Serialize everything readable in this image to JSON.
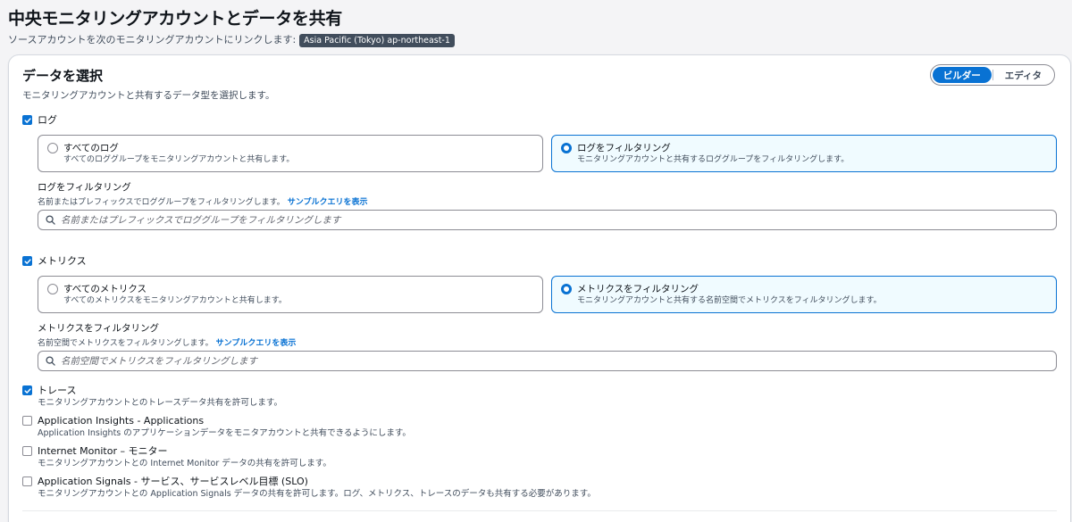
{
  "header": {
    "title": "中央モニタリングアカウントとデータを共有",
    "subtitle": "ソースアカウントを次のモニタリングアカウントにリンクします:",
    "region_badge": "Asia Pacific (Tokyo) ap-northeast-1"
  },
  "card": {
    "title": "データを選択",
    "description": "モニタリングアカウントと共有するデータ型を選択します。",
    "mode_toggle": {
      "builder_label": "ビルダー",
      "editor_label": "エディタ",
      "selected": "ビルダー"
    },
    "logs": {
      "label": "ログ",
      "checked": true,
      "option_all": {
        "label": "すべてのログ",
        "description": "すべてのロググループをモニタリングアカウントと共有します。"
      },
      "option_filter": {
        "label": "ログをフィルタリング",
        "description": "モニタリングアカウントと共有するロググループをフィルタリングします。"
      },
      "selected_option": "filter",
      "filter": {
        "label": "ログをフィルタリング",
        "description": "名前またはプレフィックスでロググループをフィルタリングします。",
        "link": "サンプルクエリを表示",
        "placeholder": "名前またはプレフィックスでロググループをフィルタリングします",
        "value": ""
      }
    },
    "metrics": {
      "label": "メトリクス",
      "checked": true,
      "option_all": {
        "label": "すべてのメトリクス",
        "description": "すべてのメトリクスをモニタリングアカウントと共有します。"
      },
      "option_filter": {
        "label": "メトリクスをフィルタリング",
        "description": "モニタリングアカウントと共有する名前空間でメトリクスをフィルタリングします。"
      },
      "selected_option": "filter",
      "filter": {
        "label": "メトリクスをフィルタリング",
        "description": "名前空間でメトリクスをフィルタリングします。",
        "link": "サンプルクエリを表示",
        "placeholder": "名前空間でメトリクスをフィルタリングします",
        "value": ""
      }
    },
    "traces": {
      "label": "トレース",
      "description": "モニタリングアカウントとのトレースデータ共有を許可します。",
      "checked": true
    },
    "app_insights": {
      "label": "Application Insights - Applications",
      "description": "Application Insights のアプリケーションデータをモニタアカウントと共有できるようにします。",
      "checked": false
    },
    "internet_monitor": {
      "label": "Internet Monitor – モニター",
      "description": "モニタリングアカウントとの Internet Monitor データの共有を許可します。",
      "checked": false
    },
    "app_signals": {
      "label": "Application Signals - サービス、サービスレベル目標 (SLO)",
      "description": "モニタリングアカウントとの Application Signals データの共有を許可します。ログ、メトリクス、トレースのデータも共有する必要があります。",
      "checked": false
    }
  },
  "colors": {
    "accent": "#0972d3",
    "selected_tile_bg": "#f0fbff",
    "text_primary": "#0f141a",
    "text_secondary": "#414d5c"
  }
}
